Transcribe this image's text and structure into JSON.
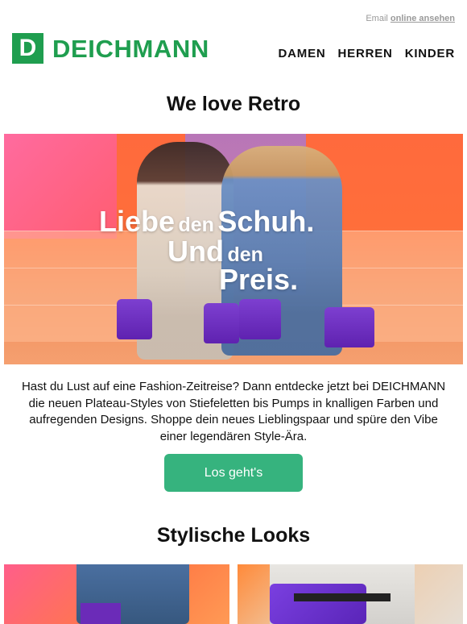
{
  "header": {
    "email_prefix": "Email",
    "online_link": "online ansehen",
    "logo_letter": "D",
    "logo_text": "DEICHMANN",
    "nav": [
      {
        "label": "DAMEN"
      },
      {
        "label": "HERREN"
      },
      {
        "label": "KINDER"
      }
    ],
    "brand_color": "#1f9e4f"
  },
  "main": {
    "title": "We love Retro",
    "hero": {
      "line1_a": "Liebe",
      "line1_b": "den",
      "line1_c": "Schuh.",
      "line2_a": "Und",
      "line2_b": "den",
      "line3": "Preis."
    },
    "paragraph": "Hast du Lust auf eine Fashion-Zeitreise? Dann entdecke jetzt bei DEICHMANN die neuen Plateau-Styles von Stiefeletten bis Pumps in knalligen Farben und aufregenden Designs. Shoppe dein neues Lieblingspaar und spüre den Vibe einer legendären Style-Ära.",
    "cta_label": "Los geht's",
    "cta_color": "#36b37e",
    "section2_title": "Stylische Looks"
  }
}
